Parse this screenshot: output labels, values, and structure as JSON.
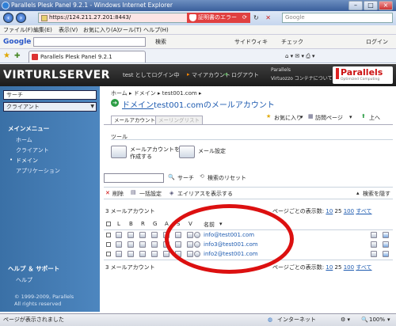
{
  "window": {
    "title": "Parallels Plesk Panel 9.2.1 - Windows Internet Explorer"
  },
  "browser": {
    "url": "https://124.211.27.201:8443/",
    "cert_error": "証明書のエラー",
    "search_placeholder": "Google",
    "menu": [
      "ファイル(F)",
      "編集(E)",
      "表示(V)",
      "お気に入り(A)",
      "ツール(T)",
      "ヘルプ(H)"
    ],
    "google_toolbar": {
      "brand": "Google",
      "search": "検索",
      "sidewiki": "サイドウィキ",
      "check": "チェック",
      "login": "ログイン"
    },
    "tab_title": "Parallels Plesk Panel 9.2.1",
    "status_text": "ページが表示されました",
    "zone": "インターネット",
    "zoom": "100%"
  },
  "header": {
    "logo": "VIRTURLSERVER",
    "login_text": "test としてログイン中",
    "my_account": "マイアカウント",
    "logout": "ログアウト",
    "virtuozzo_line1": "Parallels",
    "virtuozzo_line2": "Virtuozzo コンテナについて",
    "brand": "Parallels",
    "brand_sub": "Optimized Computing"
  },
  "sidebar": {
    "search_placeholder": "サーチ",
    "select_value": "クライアント",
    "menu_title": "メインメニュー",
    "items": [
      "ホーム",
      "クライアント",
      "ドメイン",
      "アプリケーション"
    ],
    "help_title": "ヘルプ ＆ サポート",
    "help_item": "ヘルプ",
    "copyright1": "© 1999-2009, Parallels",
    "copyright2": "All rights reserved"
  },
  "main": {
    "breadcrumb": [
      "ホーム",
      "ドメイン",
      "test001.com"
    ],
    "title_link": "ドメイン",
    "title_rest": "test001.comのメールアカウント",
    "tabs": [
      "メールアカウント",
      "メーリングリスト"
    ],
    "favorites": "お気に入り",
    "visited": "訪問ページ",
    "up": "上へ",
    "tools_label": "ツール",
    "create_account_line1": "メールアカウントを",
    "create_account_line2": "作成する",
    "mail_settings": "メール設定",
    "search_button": "サーチ",
    "reset_search": "検索のリセット",
    "delete": "削除",
    "bulk_settings": "一括設定",
    "show_aliases": "エイリアスを表示する",
    "hide_search": "検索を隠す",
    "count_text": "3 メールアカウント",
    "per_page_label": "ページごとの表示数:",
    "per_page_options": [
      "10",
      "25",
      "100",
      "すべて"
    ],
    "columns": [
      "L",
      "B",
      "R",
      "G",
      "A",
      "S",
      "V",
      "名前"
    ],
    "accounts": [
      "info@test001.com",
      "info3@test001.com",
      "info2@test001.com"
    ]
  }
}
